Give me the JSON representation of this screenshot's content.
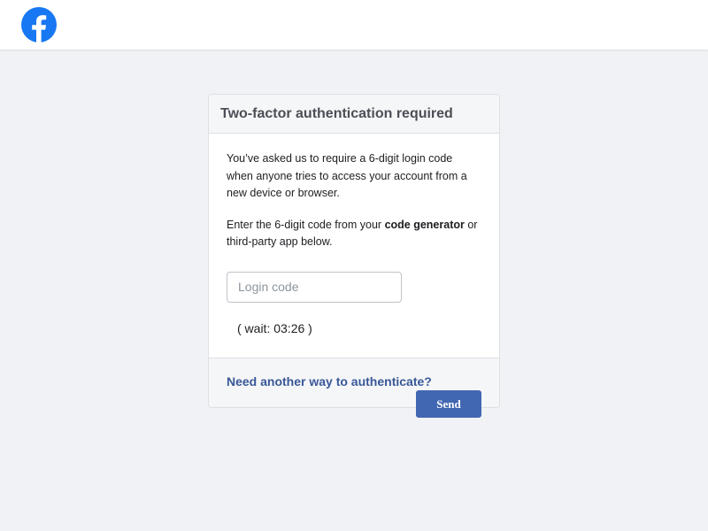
{
  "header": {
    "logo_icon": "facebook-logo-icon",
    "logo_text": "f",
    "brand_color": "#1877f2"
  },
  "card": {
    "title": "Two-factor authentication required",
    "para1": "You’ve asked us to require a 6-digit login code when anyone tries to access your account from a new device or browser.",
    "para2_before": "Enter the 6-digit code from your ",
    "para2_bold": "code generator",
    "para2_after": " or third-party app below.",
    "input": {
      "value": "",
      "placeholder": "Login code"
    },
    "wait_text": "( wait: 03:26 )"
  },
  "footer": {
    "alt_link": "Need another way to authenticate?",
    "send_label": "Send",
    "send_color": "#4267b2"
  }
}
